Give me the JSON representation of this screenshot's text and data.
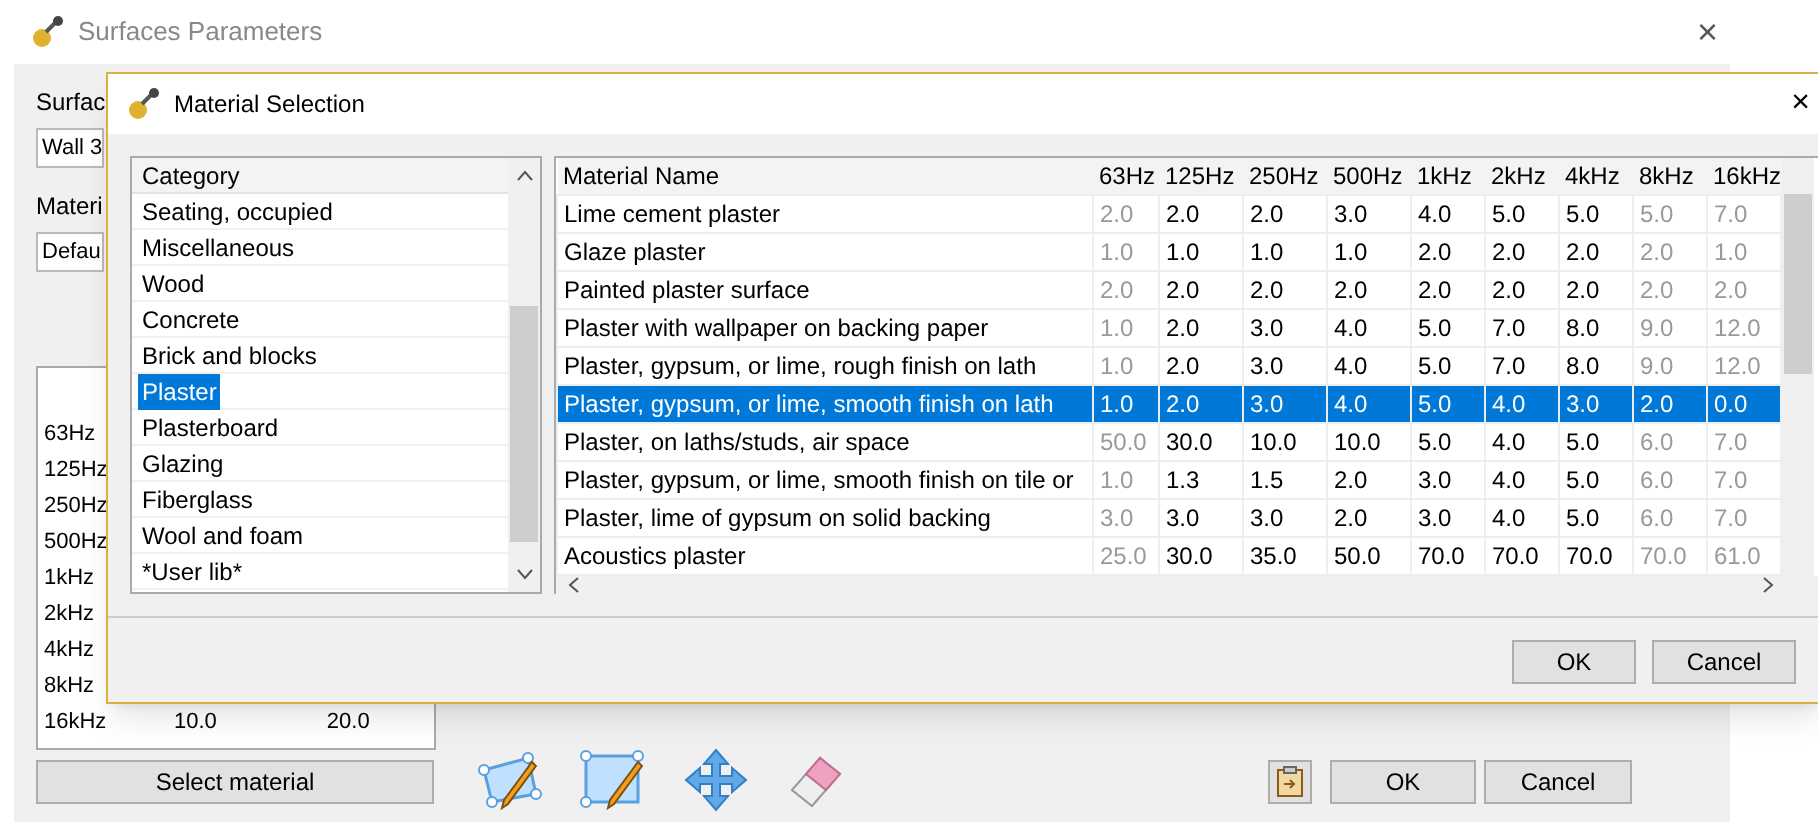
{
  "window": {
    "title": "Surfaces Parameters",
    "close": "×"
  },
  "background": {
    "surface_label": "Surfac",
    "surface_value": "Wall 3",
    "material_label": "Materi",
    "material_value": "Defau",
    "frequencies": [
      "63Hz",
      "125Hz",
      "250Hz",
      "500Hz",
      "1kHz",
      "2kHz",
      "4kHz",
      "8kHz",
      "16kHz"
    ],
    "last_row_values": [
      "10.0",
      "20.0"
    ],
    "select_button": "Select material",
    "ok": "OK",
    "cancel": "Cancel"
  },
  "dialog": {
    "title": "Material Selection",
    "close": "×",
    "category_header": "Category",
    "categories": [
      {
        "label": "Seating, occupied",
        "selected": false
      },
      {
        "label": "Miscellaneous",
        "selected": false
      },
      {
        "label": "Wood",
        "selected": false
      },
      {
        "label": "Concrete",
        "selected": false
      },
      {
        "label": "Brick and blocks",
        "selected": false
      },
      {
        "label": "Plaster",
        "selected": true
      },
      {
        "label": "Plasterboard",
        "selected": false
      },
      {
        "label": "Glazing",
        "selected": false
      },
      {
        "label": "Fiberglass",
        "selected": false
      },
      {
        "label": "Wool and foam",
        "selected": false
      },
      {
        "label": "*User lib*",
        "selected": false
      }
    ],
    "columns": [
      {
        "label": "Material Name",
        "dimmed": false
      },
      {
        "label": "63Hz",
        "dimmed": true
      },
      {
        "label": "125Hz",
        "dimmed": false
      },
      {
        "label": "250Hz",
        "dimmed": false
      },
      {
        "label": "500Hz",
        "dimmed": false
      },
      {
        "label": "1kHz",
        "dimmed": false
      },
      {
        "label": "2kHz",
        "dimmed": false
      },
      {
        "label": "4kHz",
        "dimmed": false
      },
      {
        "label": "8kHz",
        "dimmed": true
      },
      {
        "label": "16kHz",
        "dimmed": true
      }
    ],
    "rows": [
      {
        "cells": [
          "Lime cement plaster",
          "2.0",
          "2.0",
          "2.0",
          "3.0",
          "4.0",
          "5.0",
          "5.0",
          "5.0",
          "7.0"
        ],
        "selected": false
      },
      {
        "cells": [
          "Glaze plaster",
          "1.0",
          "1.0",
          "1.0",
          "1.0",
          "2.0",
          "2.0",
          "2.0",
          "2.0",
          "1.0"
        ],
        "selected": false
      },
      {
        "cells": [
          "Painted plaster surface",
          "2.0",
          "2.0",
          "2.0",
          "2.0",
          "2.0",
          "2.0",
          "2.0",
          "2.0",
          "2.0"
        ],
        "selected": false
      },
      {
        "cells": [
          "Plaster with wallpaper on backing paper",
          "1.0",
          "2.0",
          "3.0",
          "4.0",
          "5.0",
          "7.0",
          "8.0",
          "9.0",
          "12.0"
        ],
        "selected": false
      },
      {
        "cells": [
          "Plaster, gypsum, or lime, rough finish on lath",
          "1.0",
          "2.0",
          "3.0",
          "4.0",
          "5.0",
          "7.0",
          "8.0",
          "9.0",
          "12.0"
        ],
        "selected": false
      },
      {
        "cells": [
          "Plaster, gypsum, or lime, smooth finish on lath",
          "1.0",
          "2.0",
          "3.0",
          "4.0",
          "5.0",
          "4.0",
          "3.0",
          "2.0",
          "0.0"
        ],
        "selected": true
      },
      {
        "cells": [
          "Plaster, on laths/studs, air space",
          "50.0",
          "30.0",
          "10.0",
          "10.0",
          "5.0",
          "4.0",
          "5.0",
          "6.0",
          "7.0"
        ],
        "selected": false
      },
      {
        "cells": [
          "Plaster, gypsum, or lime, smooth finish on tile or",
          "1.0",
          "1.3",
          "1.5",
          "2.0",
          "3.0",
          "4.0",
          "5.0",
          "6.0",
          "7.0"
        ],
        "selected": false
      },
      {
        "cells": [
          "Plaster, lime of gypsum on solid backing",
          "3.0",
          "3.0",
          "3.0",
          "2.0",
          "3.0",
          "4.0",
          "5.0",
          "6.0",
          "7.0"
        ],
        "selected": false
      },
      {
        "cells": [
          "Acoustics plaster",
          "25.0",
          "30.0",
          "35.0",
          "50.0",
          "70.0",
          "70.0",
          "70.0",
          "70.0",
          "61.0"
        ],
        "selected": false
      }
    ],
    "ok": "OK",
    "cancel": "Cancel"
  }
}
